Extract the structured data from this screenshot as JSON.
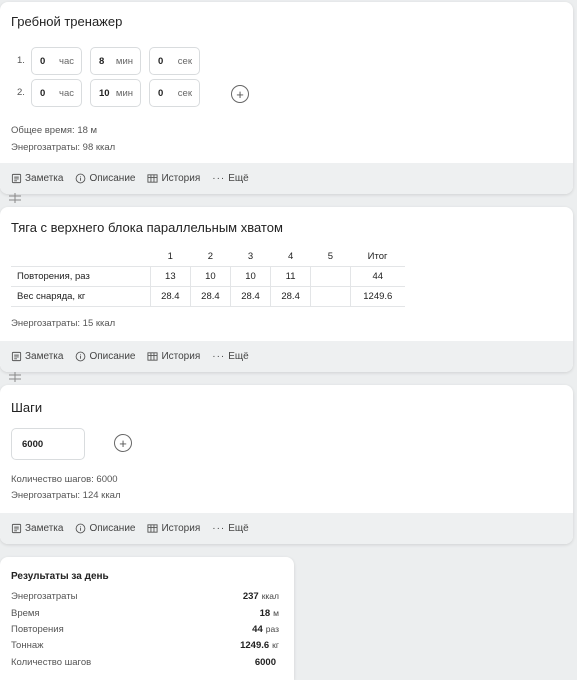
{
  "footer": {
    "note": "Заметка",
    "description": "Описание",
    "history": "История",
    "more": "Ещё"
  },
  "rowing": {
    "title": "Гребной тренажер",
    "rows": [
      {
        "num": "1.",
        "hours": "0",
        "minutes": "8",
        "seconds": "0"
      },
      {
        "num": "2.",
        "hours": "0",
        "minutes": "10",
        "seconds": "0"
      }
    ],
    "units": {
      "hours": "час",
      "minutes": "мин",
      "seconds": "сек"
    },
    "total_time": "Общее время: 18 м",
    "energy": "Энергозатраты: 98 ккал"
  },
  "pulldown": {
    "title": "Тяга с верхнего блока параллельным хватом",
    "columns": [
      "1",
      "2",
      "3",
      "4",
      "5",
      "Итог"
    ],
    "rows": [
      {
        "label": "Повторения, раз",
        "values": [
          "13",
          "10",
          "10",
          "11",
          "",
          "44"
        ]
      },
      {
        "label": "Вес снаряда, кг",
        "values": [
          "28.4",
          "28.4",
          "28.4",
          "28.4",
          "",
          "1249.6"
        ]
      }
    ],
    "energy": "Энергозатраты: 15 ккал"
  },
  "steps": {
    "title": "Шаги",
    "value": "6000",
    "count": "Количество шагов: 6000",
    "energy": "Энергозатраты: 124 ккал"
  },
  "results": {
    "title": "Результаты за день",
    "rows": [
      {
        "label": "Энергозатраты",
        "value": "237",
        "unit": "ккал"
      },
      {
        "label": "Время",
        "value": "18",
        "unit": "м"
      },
      {
        "label": "Повторения",
        "value": "44",
        "unit": "раз"
      },
      {
        "label": "Тоннаж",
        "value": "1249.6",
        "unit": "кг"
      },
      {
        "label": "Количество шагов",
        "value": "6000",
        "unit": ""
      }
    ]
  },
  "icons": [
    "note-icon",
    "info-icon",
    "history-icon",
    "more-icon",
    "plus-icon",
    "separator-icon"
  ]
}
